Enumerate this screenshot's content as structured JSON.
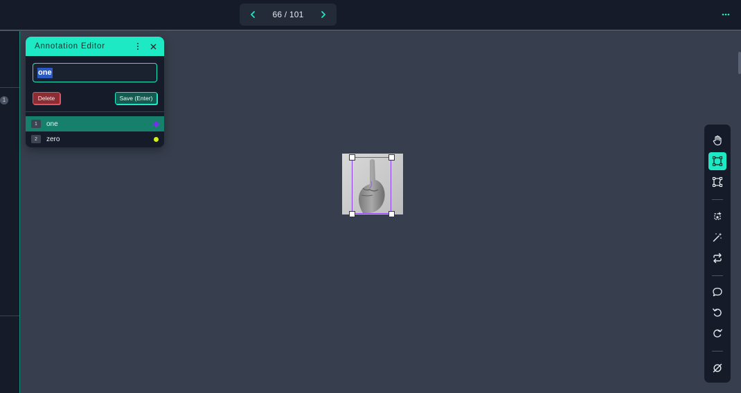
{
  "pager": {
    "current_text": "66 / 101"
  },
  "editor": {
    "title": "Annotation Editor",
    "input_value": "one",
    "delete_label": "Delete",
    "save_label": "Save (Enter)",
    "labels": [
      {
        "num": "1",
        "name": "one",
        "color": "#7b2cf0",
        "selected": true
      },
      {
        "num": "2",
        "name": "zero",
        "color": "#d4f01c",
        "selected": false
      }
    ]
  },
  "left_panel": {
    "badge": "1"
  },
  "bbox_color": "#8a3ff5",
  "accent_color": "#1de9c4",
  "toolbar": {
    "tools": [
      "hand-icon",
      "bounding-box-icon",
      "polygon-icon",
      "auto-segment-icon",
      "magic-wand-icon",
      "swap-icon",
      "comment-icon",
      "undo-icon",
      "redo-icon",
      "hide-icon"
    ],
    "active_tool": "bounding-box-icon"
  }
}
